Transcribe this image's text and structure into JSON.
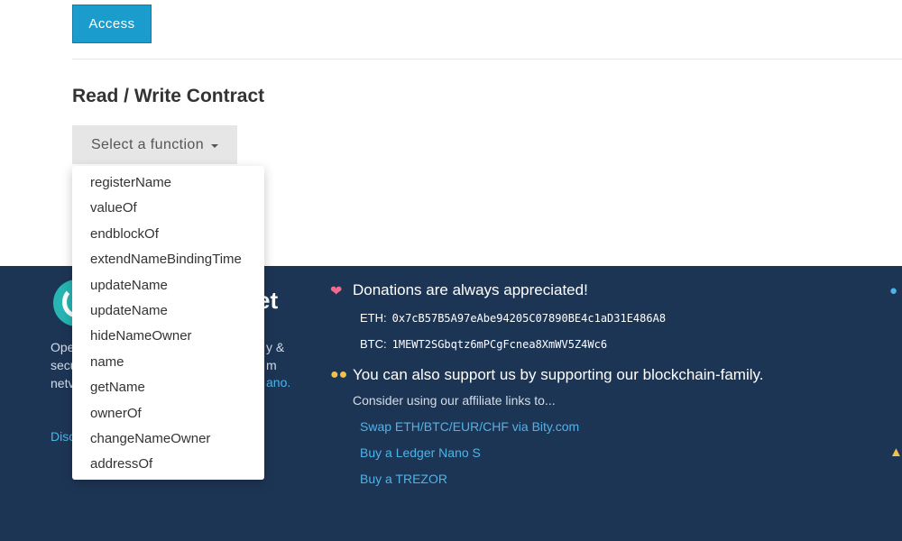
{
  "access_label": "Access",
  "section_title": "Read / Write Contract",
  "select_function": {
    "label": "Select a function"
  },
  "dropdown": {
    "items": [
      "registerName",
      "valueOf",
      "endblockOf",
      "extendNameBindingTime",
      "updateName",
      "updateName",
      "hideNameOwner",
      "name",
      "getName",
      "ownerOf",
      "changeNameOwner",
      "addressOf"
    ]
  },
  "footer": {
    "logo_suffix": "et",
    "about_lines": [
      "Ope",
      "secu",
      "netv"
    ],
    "about_right_fragments": [
      "y &",
      "m",
      "ano."
    ],
    "about_link": "Disc",
    "donations_title": "Donations are always appreciated!",
    "eth_label": "ETH:",
    "eth_address": "0x7cB57B5A97eAbe94205C07890BE4c1aD31E486A8",
    "btc_label": "BTC:",
    "btc_address": "1MEWT2SGbqtz6mPCgFcnea8XmWV5Z4Wc6",
    "family_title": "You can also support us by supporting our blockchain-family.",
    "consider_text": "Consider using our affiliate links to...",
    "affiliate_links": [
      "Swap ETH/BTC/EUR/CHF via Bity.com",
      "Buy a Ledger Nano S",
      "Buy a TREZOR"
    ],
    "icons": {
      "donation": "heart-icon",
      "family": "family-icon",
      "right_top": "globe-icon",
      "right_bottom": "praying-icon"
    }
  },
  "colors": {
    "access_button": "#1a9dcc",
    "footer_bg": "#1d3555",
    "link": "#4fb3e8",
    "select_bg": "#e6e6e6"
  }
}
